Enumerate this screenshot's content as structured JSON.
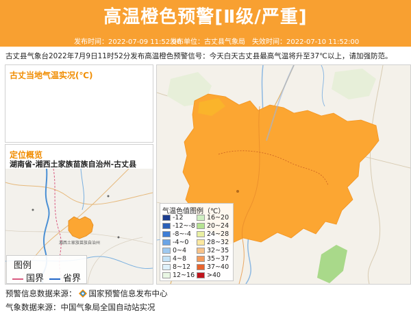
{
  "header": {
    "title": "高温橙色预警[Ⅱ级/严重]",
    "publish_time": "发布时间：2022-07-09 11:52:00",
    "publisher": "发布单位：古丈县气象局",
    "expire_time": "失效时间：2022-07-10 11:52:00"
  },
  "description": "古丈县气象台2022年7月9日11时52分发布高温橙色预警信号：今天白天古丈县最高气温将升至37℃以上，请加强防范。",
  "colors": {
    "header_bg": "#f8a031",
    "warning_fill": "#fca632",
    "panel_title": "#f08c00"
  },
  "temp_panel": {
    "title": "古丈当地气温实况(℃)"
  },
  "location_panel": {
    "title": "定位概览",
    "subtitle": "湖南省-湘西土家族苗族自治州-古丈县",
    "map_labels": [
      "湘西土家族苗族自治州"
    ],
    "legend": {
      "title": "图例",
      "national_border": "国界",
      "provincial_border": "省界"
    }
  },
  "temp_legend": {
    "title": "气温色值图例（℃）",
    "items": [
      {
        "label": "-12",
        "color": "#1b3d8f"
      },
      {
        "label": "-12~-8",
        "color": "#2a5fb8"
      },
      {
        "label": "-8~-4",
        "color": "#3f7ed6"
      },
      {
        "label": "-4~0",
        "color": "#6aa4e6"
      },
      {
        "label": "0~4",
        "color": "#9fc9f0"
      },
      {
        "label": "4~8",
        "color": "#c3e2f7"
      },
      {
        "label": "8~12",
        "color": "#dff1fb"
      },
      {
        "label": "12~16",
        "color": "#e9f7e4"
      },
      {
        "label": "16~20",
        "color": "#cfeec0"
      },
      {
        "label": "20~24",
        "color": "#b6e391"
      },
      {
        "label": "24~28",
        "color": "#e9f0a3"
      },
      {
        "label": "28~32",
        "color": "#fbe8a0"
      },
      {
        "label": "32~35",
        "color": "#f8c38a"
      },
      {
        "label": "35~37",
        "color": "#f49a5b"
      },
      {
        "label": "37~40",
        "color": "#e8632c"
      },
      {
        "label": ">40",
        "color": "#c0141c"
      }
    ]
  },
  "footer": {
    "warning_source_label": "预警信息数据来源：",
    "warning_source": "国家预警信息发布中心",
    "weather_source": "气象数据来源：中国气象局全国自动站实况"
  }
}
